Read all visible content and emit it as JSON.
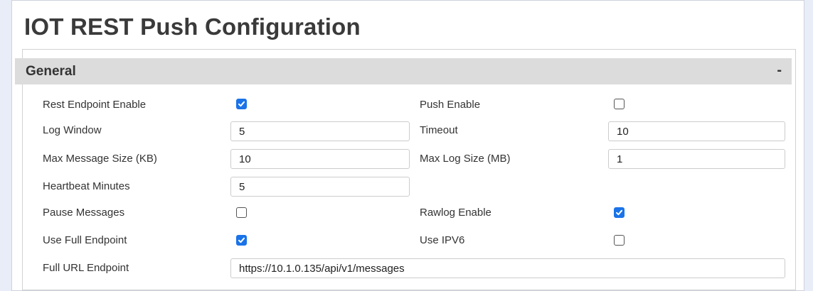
{
  "page": {
    "title": "IOT REST Push Configuration"
  },
  "section": {
    "title": "General",
    "collapse_label": "-"
  },
  "labels": {
    "rest_endpoint_enable": "Rest Endpoint Enable",
    "push_enable": "Push Enable",
    "log_window": "Log Window",
    "timeout": "Timeout",
    "max_message_size": "Max Message Size (KB)",
    "max_log_size": "Max Log Size (MB)",
    "heartbeat_minutes": "Heartbeat Minutes",
    "pause_messages": "Pause Messages",
    "rawlog_enable": "Rawlog Enable",
    "use_full_endpoint": "Use Full Endpoint",
    "use_ipv6": "Use IPV6",
    "full_url_endpoint": "Full URL Endpoint"
  },
  "values": {
    "log_window": "5",
    "timeout": "10",
    "max_message_size": "10",
    "max_log_size": "1",
    "heartbeat_minutes": "5",
    "full_url_endpoint": "https://10.1.0.135/api/v1/messages"
  },
  "checkboxes": {
    "rest_endpoint_enable": true,
    "push_enable": false,
    "pause_messages": false,
    "rawlog_enable": true,
    "use_full_endpoint": true,
    "use_ipv6": false
  },
  "colors": {
    "checkbox_checked": "#1a73e8",
    "header_background": "#dcdcdc",
    "page_background": "#e9edf7"
  }
}
